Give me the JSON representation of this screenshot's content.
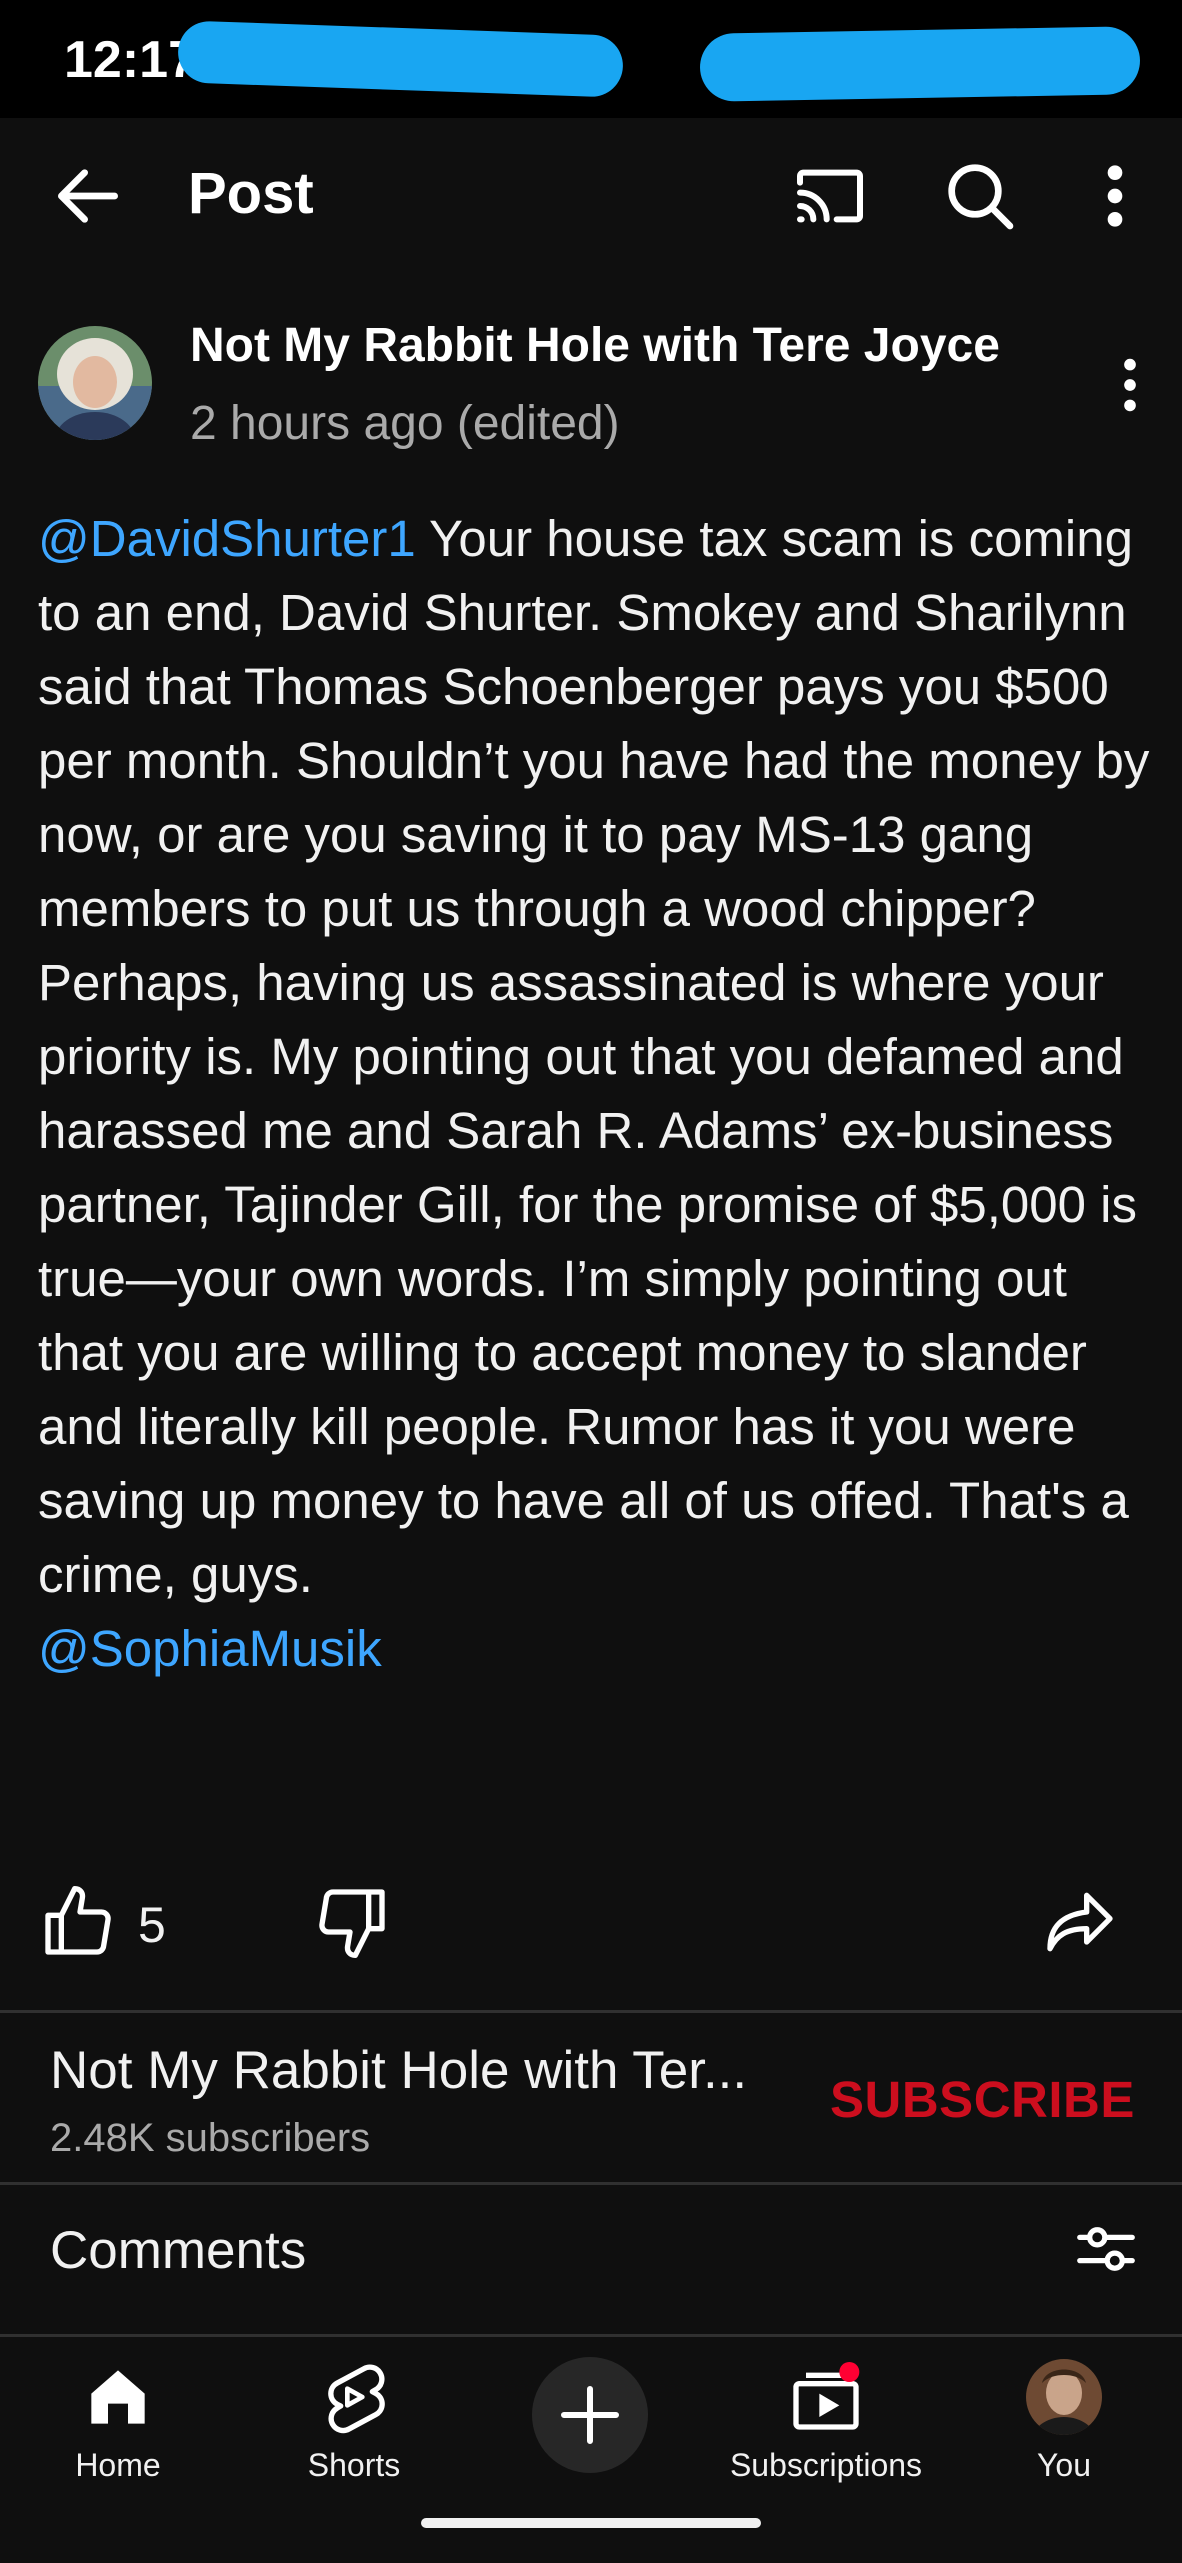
{
  "status_bar": {
    "time": "12:17"
  },
  "header": {
    "title": "Post"
  },
  "post": {
    "channel_name": "Not My Rabbit Hole with Tere Joyce",
    "time": "2 hours ago (edited)",
    "mention_start": "@DavidShurter1",
    "body": " Your house tax scam is coming to an end, David Shurter. Smokey and Sharilynn said that Thomas Schoenberger pays you $500 per month. Shouldn’t you have had the money by now, or are you saving it to pay MS-13 gang members to put us through a wood chipper?  Perhaps, having us assassinated is where your priority is. My pointing out that you defamed and harassed me and Sarah R. Adams’ ex-business partner, Tajinder Gill, for the promise of $5,000 is true—your own words. I’m simply pointing out that you are willing to accept money to slander and literally kill people. Rumor has it you were saving up money to have all of us offed. That's a crime, guys.",
    "mention_end": "@SophiaMusik",
    "like_count": "5"
  },
  "channel_row": {
    "name": "Not My Rabbit Hole with Ter...",
    "subscribers": "2.48K subscribers",
    "subscribe_label": "SUBSCRIBE"
  },
  "comments": {
    "title": "Comments"
  },
  "bottom_nav": {
    "home": "Home",
    "shorts": "Shorts",
    "subscriptions": "Subscriptions",
    "you": "You"
  },
  "colors": {
    "background": "#0f0f0f",
    "mention": "#3ea6ff",
    "subscribe": "#cc0e1e",
    "secondary_text": "#aaaaaa"
  }
}
